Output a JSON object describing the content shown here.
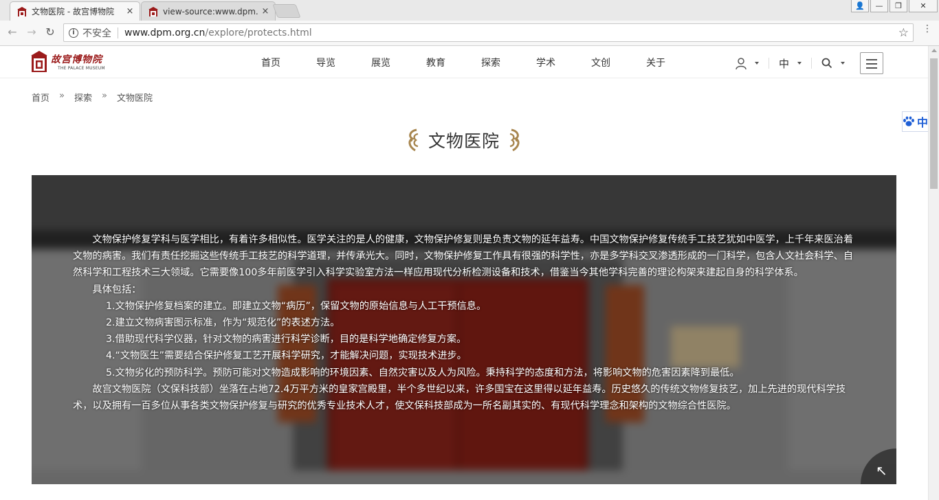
{
  "browser": {
    "tabs": [
      {
        "title": "文物医院 - 故宫博物院",
        "close": "×"
      },
      {
        "title": "view-source:www.dpm.",
        "close": "×"
      }
    ],
    "window_buttons": {
      "user": "👤",
      "minimize": "—",
      "restore": "❐",
      "close": "✕"
    },
    "nav": {
      "back": "←",
      "forward": "→",
      "reload": "↻"
    },
    "address": {
      "security_label": "不安全",
      "host": "www.dpm.org.cn",
      "path": "/explore/protects.html"
    },
    "bookmark_icon": "☆"
  },
  "site": {
    "logo": {
      "cn": "故宫博物院",
      "en": "THE PALACE MUSEUM"
    },
    "nav_items": [
      "首页",
      "导览",
      "展览",
      "教育",
      "探索",
      "学术",
      "文创",
      "关于"
    ],
    "language": "中"
  },
  "breadcrumb": {
    "items": [
      "首页",
      "探索",
      "文物医院"
    ],
    "separator": "»"
  },
  "page_title": "文物医院",
  "content": {
    "intro": "文物保护修复学科与医学相比，有着许多相似性。医学关注的是人的健康，文物保护修复则是负责文物的延年益寿。中国文物保护修复传统手工技艺犹如中医学，上千年来医治着文物的病害。我们有责任挖掘这些传统手工技艺的科学道理，并传承光大。同时，文物保护修复工作具有很强的科学性，亦是多学科交叉渗透形成的一门科学，包含人文社会科学、自然科学和工程技术三大领域。它需要像100多年前医学引入科学实验室方法一样应用现代分析检测设备和技术，借鉴当今其他学科完善的理论构架来建起自身的科学体系。",
    "includes_label": "具体包括：",
    "items": [
      "1.文物保护修复档案的建立。即建立文物“病历”，保留文物的原始信息与人工干预信息。",
      "2.建立文物病害图示标准，作为“规范化”的表述方法。",
      "3.借助现代科学仪器，针对文物的病害进行科学诊断，目的是科学地确定修复方案。",
      "4.“文物医生”需要结合保护修复工艺开展科学研究，才能解决问题，实现技术进步。",
      "5.文物劣化的预防科学。预防可能对文物造成影响的环境因素、自然灾害以及人为风险。秉持科学的态度和方法，将影响文物的危害因素降到最低。"
    ],
    "closing": "故宫文物医院（文保科技部）坐落在占地72.4万平方米的皇家宫殿里，半个多世纪以来，许多国宝在这里得以延年益寿。历史悠久的传统文物修复技艺，加上先进的现代科学技术，以及拥有一百多位从事各类文物保护修复与研究的优秀专业技术人才，使文保科技部成为一所名副其实的、有现代科学理念和架构的文物综合性医院。"
  },
  "side_tab": {
    "label": "中"
  },
  "colors": {
    "brand_red": "#9b1b1b",
    "ornament_gold": "#a8864f",
    "side_tab_blue": "#1f5fd6"
  }
}
